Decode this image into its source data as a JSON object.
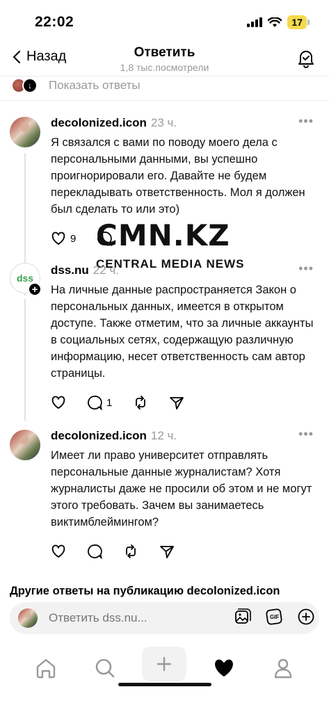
{
  "status_bar": {
    "time": "22:02",
    "battery": "17"
  },
  "nav": {
    "back_label": "Назад",
    "title": "Ответить",
    "subtitle": "1,8 тыс.посмотрели"
  },
  "show_replies": {
    "label": "Показать ответы"
  },
  "posts": [
    {
      "author": "decolonized.icon",
      "time": "23 ч.",
      "text": "Я связался с вами по поводу моего дела с персональными данными, вы успешно проигнорировали его. Давайте не будем перекладывать ответственность. Мол я должен был сделать то или это)",
      "likes": "9"
    },
    {
      "author": "dss.nu",
      "time": "22 ч.",
      "text": "На личные данные распространяется Закон о персональных данных, имеется в открытом доступе. Также отметим, что за личные аккаунты в социальных сетях, содержащую различную информацию, несет ответственность сам автор страницы.",
      "avatar_text": "dss",
      "comments": "1"
    },
    {
      "author": "decolonized.icon",
      "time": "12 ч.",
      "text": "Имеет ли право университет отправлять персональные данные журналистам? Хотя журналисты даже не просили об этом и не могут этого требовать. Зачем вы занимаетесь виктимблеймингом?"
    }
  ],
  "watermark": {
    "logo": "CMN.KZ",
    "subtitle": "CENTRAL MEDIA NEWS"
  },
  "other_replies": "Другие ответы на публикацию decolonized.icon",
  "reply_bar": {
    "placeholder": "Ответить dss.nu..."
  },
  "icons": {
    "post_actions": [
      "heart-icon",
      "comment-icon",
      "repost-icon",
      "share-icon"
    ],
    "tabs": [
      "home-icon",
      "search-icon",
      "plus-icon",
      "heart-filled-icon",
      "profile-icon"
    ]
  },
  "colors": {
    "battery": "#f5d94a",
    "muted": "#999999",
    "divider": "#ececec"
  }
}
